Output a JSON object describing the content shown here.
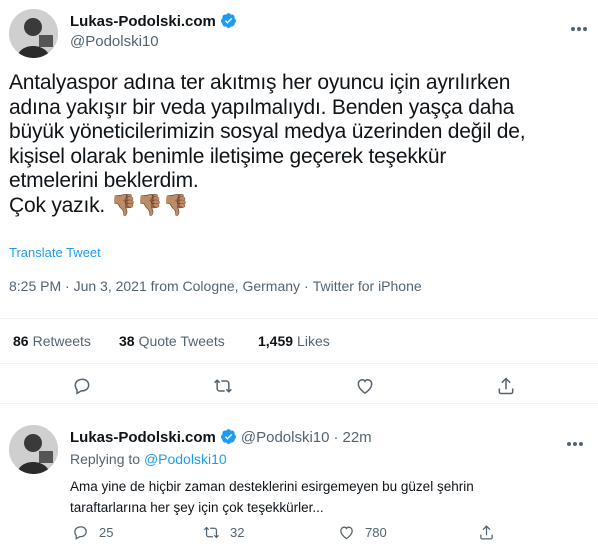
{
  "main_tweet": {
    "display_name": "Lukas-Podolski.com",
    "handle": "@Podolski10",
    "text": "Antalyaspor adına ter akıtmış her oyuncu için ayrılırken\nadına yakışır bir veda yapılmalıydı. Benden yaşça daha\nbüyük yöneticilerimizin sosyal medya üzerinden değil de,\nkişisel olarak benimle iletişime geçerek teşekkür\netmelerini beklerdim.\nÇok yazık. 👎🏽👎🏽👎🏽",
    "translate_label": "Translate Tweet",
    "time": "8:25 PM · Jun 3, 2021 from Cologne, Germany",
    "source": "Twitter for iPhone",
    "stats": {
      "retweets_count": "86",
      "retweets_label": "Retweets",
      "quotes_count": "38",
      "quotes_label": "Quote Tweets",
      "likes_count": "1,459",
      "likes_label": "Likes"
    }
  },
  "reply_tweet": {
    "display_name": "Lukas-Podolski.com",
    "handle": "@Podolski10",
    "time_ago": "22m",
    "replying_prefix": "Replying to",
    "replying_handle": "@Podolski10",
    "text": "Ama yine de hiçbir zaman desteklerini esirgemeyen bu güzel şehrin\ntaraftarlarına her şey için çok teşekkürler...",
    "replies": "25",
    "retweets": "32",
    "likes": "780"
  },
  "colors": {
    "accent": "#1d9bf0",
    "secondary_text": "#536471",
    "border": "#eff3f4"
  },
  "icons": [
    "verified-badge-icon",
    "more-icon",
    "reply-icon",
    "retweet-icon",
    "like-icon",
    "share-icon"
  ]
}
